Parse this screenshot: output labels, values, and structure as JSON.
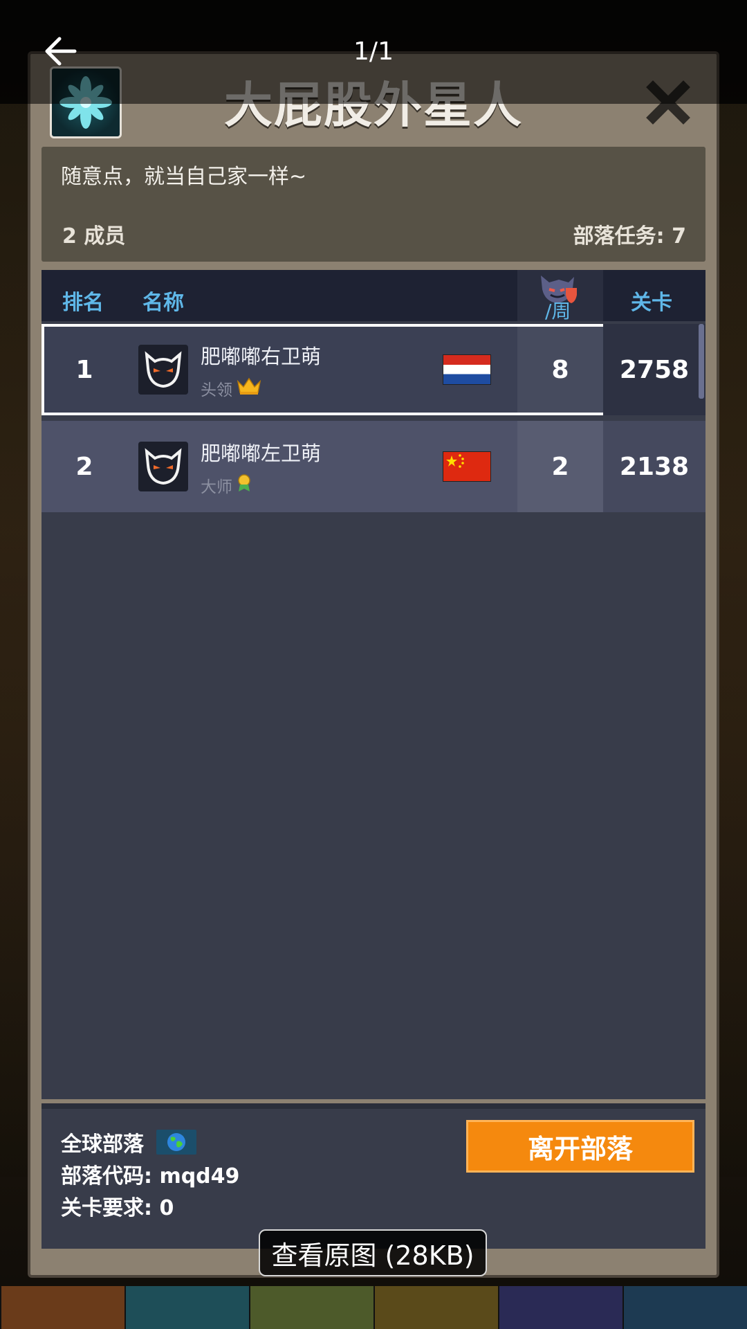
{
  "viewer": {
    "counter": "1/1",
    "view_original": "查看原图 (28KB)"
  },
  "tribe": {
    "name": "大屁股外星人",
    "description": "随意点，就当自己家一样~",
    "members": "2 成员",
    "tasks": "部落任务: 7"
  },
  "table": {
    "headers": {
      "rank": "排名",
      "name": "名称",
      "weekly": "/周",
      "level": "关卡"
    },
    "rows": [
      {
        "rank": "1",
        "name": "肥嘟嘟右卫萌",
        "role": "头领",
        "score": "8",
        "level": "2758",
        "flag": "netherlands"
      },
      {
        "rank": "2",
        "name": "肥嘟嘟左卫萌",
        "role": "大师",
        "score": "2",
        "level": "2138",
        "flag": "china"
      }
    ]
  },
  "footer": {
    "global": "全球部落",
    "code": "部落代码: mqd49",
    "requirement": "关卡要求:  0",
    "leave_button": "离开部落"
  },
  "colors": {
    "accent_orange": "#f5890e",
    "header_blue": "#5fb7e8",
    "panel_dark": "#383c4a"
  },
  "icons": [
    "back-arrow-icon",
    "tribe-flower-icon",
    "close-icon",
    "devil-avatar-icon",
    "crown-icon",
    "medal-icon",
    "globe-icon",
    "devil-shield-icon"
  ]
}
